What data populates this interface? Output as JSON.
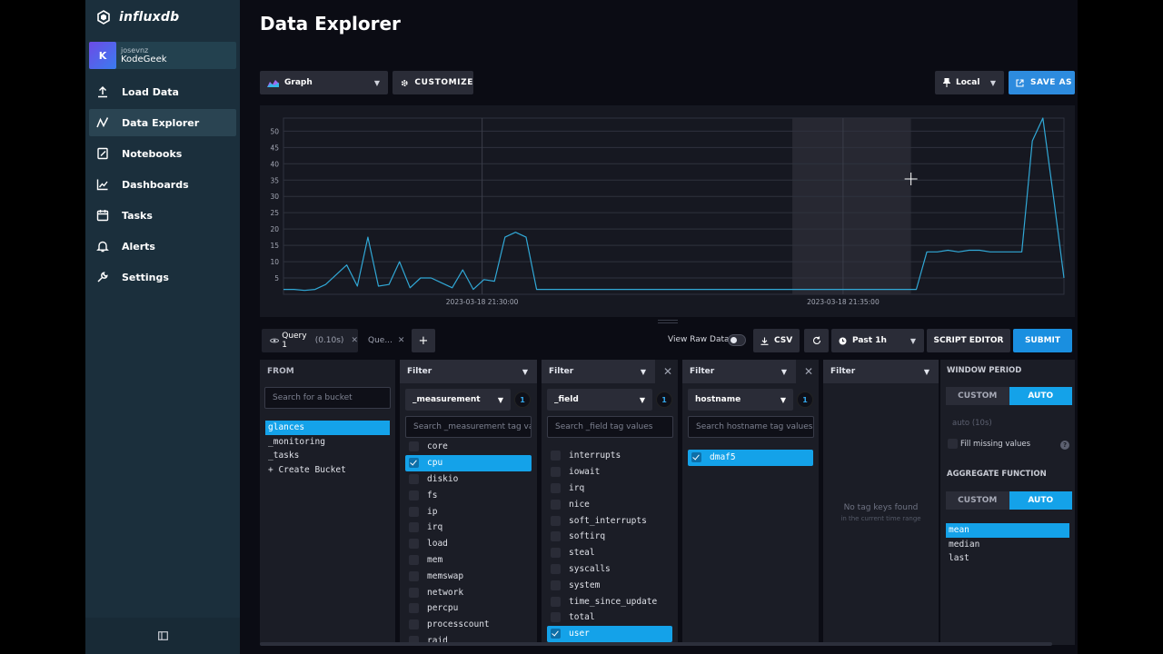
{
  "brand": {
    "name": "influxdb"
  },
  "user": {
    "initial": "K",
    "username": "josevnz",
    "org": "KodeGeek"
  },
  "nav": {
    "items": [
      {
        "label": "Load Data",
        "icon": "upload-icon"
      },
      {
        "label": "Data Explorer",
        "icon": "graph-line-icon"
      },
      {
        "label": "Notebooks",
        "icon": "notebook-icon"
      },
      {
        "label": "Dashboards",
        "icon": "dashboard-icon"
      },
      {
        "label": "Tasks",
        "icon": "calendar-icon"
      },
      {
        "label": "Alerts",
        "icon": "bell-icon"
      },
      {
        "label": "Settings",
        "icon": "wrench-icon"
      }
    ]
  },
  "page": {
    "title": "Data Explorer"
  },
  "toolbar": {
    "vis_type": "Graph",
    "customize": "CUSTOMIZE",
    "timezone": "Local",
    "save_as": "SAVE AS"
  },
  "chart_data": {
    "type": "line",
    "y_ticks": [
      5,
      10,
      15,
      20,
      25,
      30,
      35,
      40,
      45,
      50
    ],
    "ylim": [
      0,
      54
    ],
    "x_tick_labels": [
      "2023-03-18 21:30:00",
      "2023-03-18 21:35:00"
    ],
    "color": "#31a8d6",
    "values": [
      1.5,
      1.5,
      1.2,
      1.5,
      3,
      6,
      9,
      2.5,
      17.5,
      2.5,
      3,
      10,
      2,
      5,
      5,
      3.5,
      2,
      7.5,
      1.5,
      4.5,
      4,
      17.5,
      19,
      17.5,
      1.5,
      1.5,
      1.5,
      1.5,
      1.5,
      1.5,
      1.5,
      1.5,
      1.5,
      1.5,
      1.5,
      1.5,
      1.5,
      1.5,
      1.5,
      1.5,
      1.5,
      1.5,
      1.5,
      1.5,
      1.5,
      1.5,
      1.5,
      1.5,
      1.5,
      1.5,
      1.5,
      1.5,
      1.5,
      1.5,
      1.5,
      1.5,
      1.5,
      1.5,
      1.5,
      1.5,
      1.5,
      13,
      13,
      13.5,
      13,
      13.5,
      13.5,
      13,
      13,
      13,
      13,
      47,
      55,
      30,
      5
    ]
  },
  "query_bar": {
    "tab1_label": "Query 1",
    "tab1_time": "(0.10s)",
    "tab2_label": "Que...",
    "add": "+",
    "view_raw": "View Raw Data",
    "csv": "CSV",
    "time_range": "Past 1h",
    "script_editor": "SCRIPT EDITOR",
    "submit": "SUBMIT"
  },
  "from_panel": {
    "title": "FROM",
    "search_placeholder": "Search for a bucket",
    "buckets": [
      "glances",
      "_monitoring",
      "_tasks",
      "+ Create Bucket"
    ]
  },
  "filters": [
    {
      "head": "Filter",
      "key": "_measurement",
      "count": "1",
      "search_placeholder": "Search _measurement tag va",
      "values": [
        "core",
        "cpu",
        "diskio",
        "fs",
        "ip",
        "irq",
        "load",
        "mem",
        "memswap",
        "network",
        "percpu",
        "processcount",
        "raid"
      ],
      "selected": "cpu"
    },
    {
      "head": "Filter",
      "key": "_field",
      "count": "1",
      "search_placeholder": "Search _field tag values",
      "values": [
        "interrupts",
        "iowait",
        "irq",
        "nice",
        "soft_interrupts",
        "softirq",
        "steal",
        "syscalls",
        "system",
        "time_since_update",
        "total",
        "user"
      ],
      "selected": "user"
    },
    {
      "head": "Filter",
      "key": "hostname",
      "count": "1",
      "search_placeholder": "Search hostname tag values",
      "values": [
        "dmaf5"
      ],
      "selected": "dmaf5"
    },
    {
      "head": "Filter",
      "empty_title": "No tag keys found",
      "empty_sub": "in the current time range"
    }
  ],
  "window_panel": {
    "window_period_label": "WINDOW PERIOD",
    "custom": "CUSTOM",
    "auto": "AUTO",
    "auto_value": "auto (10s)",
    "fill_missing": "Fill missing values",
    "help": "?",
    "aggregate_label": "AGGREGATE FUNCTION",
    "functions": [
      "mean",
      "median",
      "last"
    ],
    "selected_function": "mean"
  }
}
